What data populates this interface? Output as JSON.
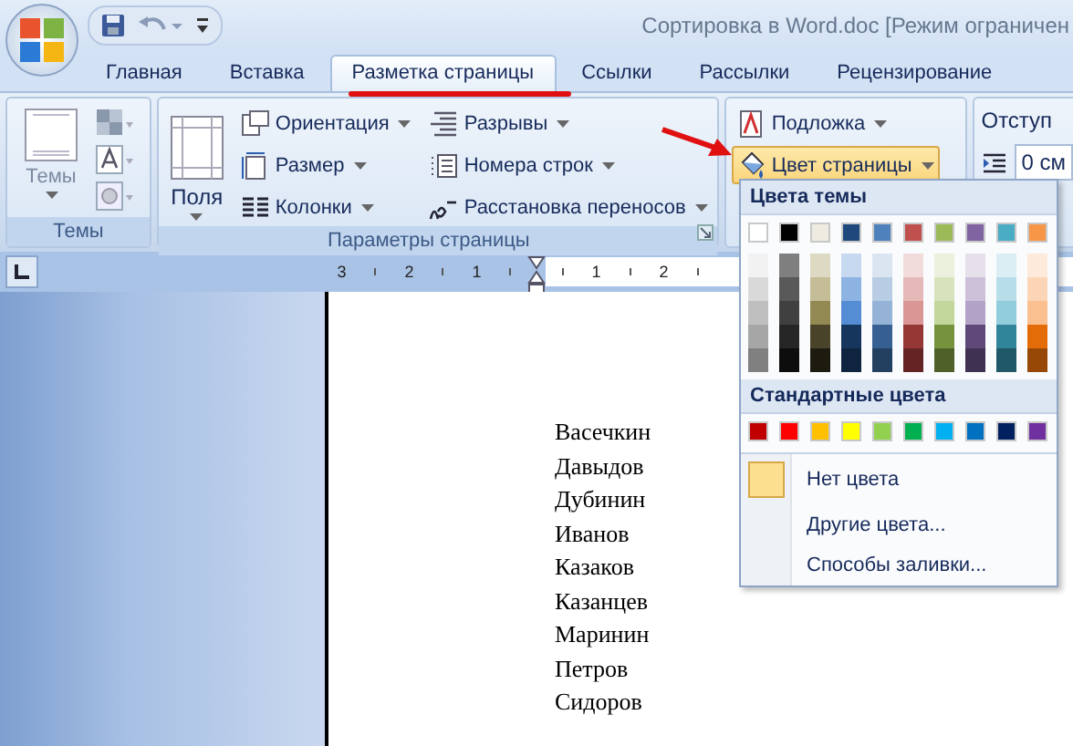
{
  "window": {
    "title": "Сортировка в Word.doc [Режим ограничен"
  },
  "tabs": [
    {
      "label": "Главная",
      "selected": false
    },
    {
      "label": "Вставка",
      "selected": false
    },
    {
      "label": "Разметка страницы",
      "selected": true
    },
    {
      "label": "Ссылки",
      "selected": false
    },
    {
      "label": "Рассылки",
      "selected": false
    },
    {
      "label": "Рецензирование",
      "selected": false
    }
  ],
  "ribbon": {
    "themes_group": {
      "label": "Темы",
      "button": {
        "label": "Темы",
        "dropdown": true
      }
    },
    "page_setup_group": {
      "label": "Параметры страницы",
      "margins": {
        "label": "Поля",
        "dropdown": true
      },
      "columns": [
        [
          {
            "kind": "orientation",
            "label": "Ориентация",
            "dropdown": true
          },
          {
            "kind": "size",
            "label": "Размер",
            "dropdown": true
          },
          {
            "kind": "columns",
            "label": "Колонки",
            "dropdown": true
          }
        ],
        [
          {
            "kind": "breaks",
            "label": "Разрывы",
            "dropdown": true
          },
          {
            "kind": "line_numbers",
            "label": "Номера строк",
            "dropdown": true
          },
          {
            "kind": "hyphenation",
            "label": "Расстановка переносов",
            "dropdown": true
          }
        ]
      ]
    },
    "background_group": {
      "items": [
        {
          "kind": "watermark",
          "label": "Подложка",
          "dropdown": true,
          "pressed": false
        },
        {
          "kind": "page_color",
          "label": "Цвет страницы",
          "dropdown": true,
          "pressed": true
        }
      ]
    },
    "indent_group": {
      "label": "Отступ",
      "field_value": "0 см"
    }
  },
  "ruler": {
    "labels": [
      "3",
      "2",
      "1",
      "1",
      "2"
    ]
  },
  "page_color_menu": {
    "theme_heading": "Цвета темы",
    "theme_colors": [
      {
        "color": "#ffffff"
      },
      {
        "color": "#000000"
      },
      {
        "color": "#eeece1"
      },
      {
        "color": "#1f497d"
      },
      {
        "color": "#4f81bd"
      },
      {
        "color": "#c0504d"
      },
      {
        "color": "#9bbb59"
      },
      {
        "color": "#8064a2"
      },
      {
        "color": "#4bacc6"
      },
      {
        "color": "#f79646"
      }
    ],
    "shade_columns": [
      [
        {
          "color": "#f2f2f2"
        },
        {
          "color": "#d9d9d9"
        },
        {
          "color": "#bfbfbf"
        },
        {
          "color": "#a6a6a6"
        },
        {
          "color": "#808080"
        }
      ],
      [
        {
          "color": "#7f7f7f"
        },
        {
          "color": "#595959"
        },
        {
          "color": "#404040"
        },
        {
          "color": "#262626"
        },
        {
          "color": "#0d0d0d"
        }
      ],
      [
        {
          "color": "#ddd9c3"
        },
        {
          "color": "#c4bd97"
        },
        {
          "color": "#938953"
        },
        {
          "color": "#494429"
        },
        {
          "color": "#1d1b10"
        }
      ],
      [
        {
          "color": "#c6d9f0"
        },
        {
          "color": "#8db3e2"
        },
        {
          "color": "#548dd4"
        },
        {
          "color": "#17365d"
        },
        {
          "color": "#0f243e"
        }
      ],
      [
        {
          "color": "#dbe5f1"
        },
        {
          "color": "#b8cce4"
        },
        {
          "color": "#95b3d7"
        },
        {
          "color": "#366092"
        },
        {
          "color": "#244061"
        }
      ],
      [
        {
          "color": "#f2dcdb"
        },
        {
          "color": "#e5b9b7"
        },
        {
          "color": "#d99694"
        },
        {
          "color": "#953734"
        },
        {
          "color": "#632423"
        }
      ],
      [
        {
          "color": "#ebf1dd"
        },
        {
          "color": "#d7e3bc"
        },
        {
          "color": "#c3d69b"
        },
        {
          "color": "#76923c"
        },
        {
          "color": "#4f6128"
        }
      ],
      [
        {
          "color": "#e5e0ec"
        },
        {
          "color": "#ccc1d9"
        },
        {
          "color": "#b2a2c7"
        },
        {
          "color": "#5f497a"
        },
        {
          "color": "#3f3151"
        }
      ],
      [
        {
          "color": "#dbeef3"
        },
        {
          "color": "#b7dde8"
        },
        {
          "color": "#92cddc"
        },
        {
          "color": "#31859b"
        },
        {
          "color": "#205867"
        }
      ],
      [
        {
          "color": "#fdeada"
        },
        {
          "color": "#fbd5b5"
        },
        {
          "color": "#fac08f"
        },
        {
          "color": "#e36c09"
        },
        {
          "color": "#974806"
        }
      ]
    ],
    "standard_heading": "Стандартные цвета",
    "standard_colors": [
      {
        "color": "#c00000"
      },
      {
        "color": "#ff0000"
      },
      {
        "color": "#ffc000"
      },
      {
        "color": "#ffff00"
      },
      {
        "color": "#92d050"
      },
      {
        "color": "#00b050"
      },
      {
        "color": "#00b0f0"
      },
      {
        "color": "#0070c0"
      },
      {
        "color": "#002060"
      },
      {
        "color": "#7030a0"
      }
    ],
    "items": [
      {
        "kind": "no_color",
        "label": "Нет цвета"
      },
      {
        "kind": "plain",
        "label": "Другие цвета..."
      },
      {
        "kind": "plain",
        "label": "Способы заливки..."
      }
    ]
  },
  "document": {
    "lines": [
      "Васечкин",
      "Давыдов",
      "Дубинин",
      "Иванов",
      "Казаков",
      "Казанцев",
      "Маринин",
      "Петров",
      "Сидоров"
    ]
  }
}
